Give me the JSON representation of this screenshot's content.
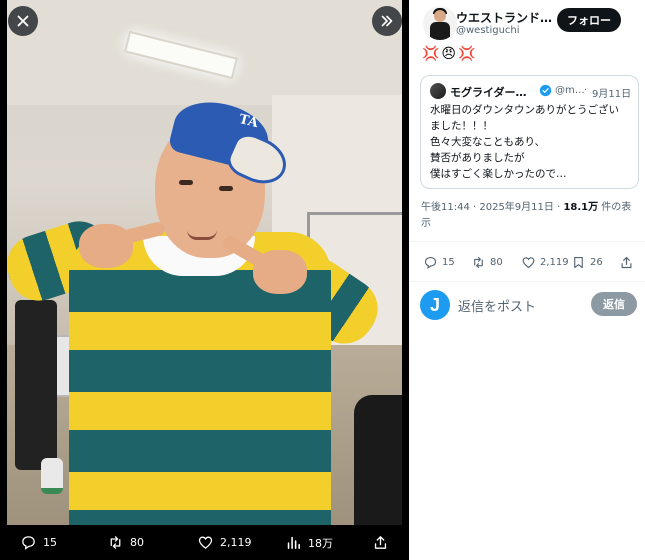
{
  "viewer": {
    "close_icon": "close-icon",
    "expand_icon": "double-chevron-right-icon",
    "cap_logo": "TA",
    "media_bar": {
      "replies": "15",
      "reposts": "80",
      "likes": "2,119",
      "views": "18万"
    }
  },
  "post": {
    "author_name": "ウエストランド…",
    "author_handle": "@westiguchi",
    "follow_label": "フォロー",
    "text": "💢😠💢",
    "quote": {
      "name": "モグライダー…",
      "handle": "@m…",
      "separator": "·",
      "date": "9月11日",
      "lines": [
        "水曜日のダウンタウンありがとうござい",
        "ました！！！",
        "色々大変なこともあり、",
        "賛否がありましたが",
        "僕はすごく楽しかったので…"
      ]
    },
    "meta": {
      "time": "午後11:44 · 2025年9月11日 · ",
      "views_count": "18.1万",
      "views_label": " 件の表示"
    },
    "actions": {
      "replies": "15",
      "reposts": "80",
      "likes": "2,119",
      "bookmarks": "26"
    }
  },
  "reply": {
    "avatar_letter": "J",
    "placeholder": "返信をポスト",
    "button_label": "返信"
  },
  "colors": {
    "accent": "#1d9bf0",
    "text": "#0f1419",
    "secondary": "#536471",
    "reply_button": "#8e9aa3"
  }
}
